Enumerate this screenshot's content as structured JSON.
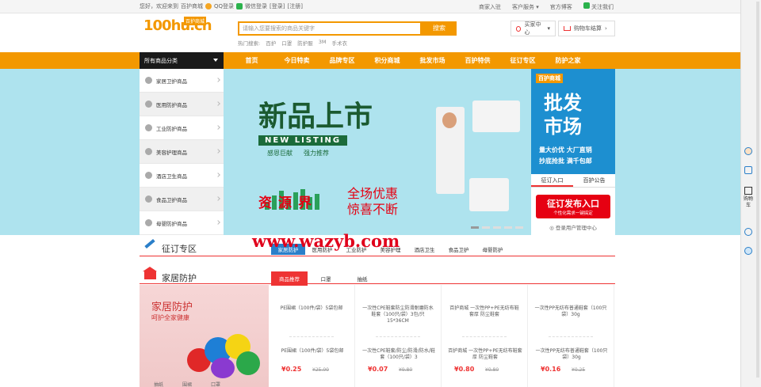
{
  "topbar": {
    "welcome": "您好，欢迎来到",
    "site_name": "百护商城",
    "qq_login": "QQ登录",
    "wechat_login": "微信登录",
    "login": "[登录]",
    "register": "[注册]",
    "merchant": "商家入驻",
    "customer_service": "客户服务",
    "official_blog": "官方博客",
    "follow_us": "关注我们"
  },
  "header": {
    "logo_text": "100hu.cn",
    "logo_badge": "百护商城",
    "search_placeholder": "请输入您要搜索的商品关键字",
    "search_button": "搜索",
    "hot_label": "热门搜索:",
    "hot_words": [
      "百护",
      "口罩",
      "防护服",
      "3M",
      "手术衣"
    ],
    "buyer_center": "买家中心",
    "cart": "购物车结算"
  },
  "nav": {
    "all_categories": "所有商品分类",
    "items": [
      "首页",
      "今日特卖",
      "品牌专区",
      "积分商城",
      "批发市场",
      "百护特供",
      "征订专区",
      "防护之家"
    ]
  },
  "categories": [
    "家居卫护商品",
    "医用防护商品",
    "工业防护商品",
    "美容护理商品",
    "酒店卫生商品",
    "食品卫护商品",
    "母婴防护商品"
  ],
  "hero": {
    "title": "新品上市",
    "title_en": "NEW LISTING",
    "sub1": "感恩巨献",
    "sub2": "强力推荐",
    "promo_line1": "全场优惠",
    "promo_line2": "惊喜不断",
    "promo_left": "资源界"
  },
  "promo": {
    "brand": "百护商城",
    "big1": "批发",
    "big2": "市场",
    "small1": "量大价优 大厂直销",
    "small2": "抄底抢批 满千包邮",
    "tab1": "征订入口",
    "tab2": "百护公告",
    "button": "征订发布入口",
    "button_sub": "个性化需求一键搞定",
    "link": "◎ 登录用户管理中心"
  },
  "watermark": "www.wazyb.com",
  "section1": {
    "title": "征订专区",
    "tabs": [
      "家居防护",
      "医用防护",
      "工业防护",
      "美容护理",
      "酒店卫生",
      "食品卫护",
      "母婴防护"
    ]
  },
  "section2": {
    "title": "家居防护",
    "tabs": [
      "商品推荐",
      "口罩",
      "抽纸"
    ]
  },
  "side_banner": {
    "title": "家居防护",
    "subtitle": "呵护全家健康",
    "labels": [
      "抽纸",
      "围裙",
      "口罩"
    ]
  },
  "products": [
    {
      "top": "PE围裙（100件/袋）5袋包邮",
      "name": "PE围裙（100件/袋）5袋包邮",
      "price": "¥0.25",
      "old": "¥25.00"
    },
    {
      "top": "一次性CPE鞋套防尘防滑耐磨防水鞋套（100只/袋）3包/只 15*36CM",
      "name": "一次性CPE鞋套/防尘/防滑/防水/鞋套（100只/袋）3",
      "price": "¥0.07",
      "old": "¥9.80"
    },
    {
      "top": "百护商城 一次性PP+PE无纺布鞋套厚 防尘鞋套",
      "name": "百护商城 一次性PP+PE无纺布鞋套厚 防尘鞋套",
      "price": "¥0.80",
      "old": "¥0.80"
    },
    {
      "top": "一次性PP无纺布普通鞋套（100只袋）30g",
      "name": "一次性PP无纺布普通鞋套（100只袋）30g",
      "price": "¥0.16",
      "old": "¥0.25"
    }
  ],
  "sidebar": {
    "cart": "购物车"
  }
}
